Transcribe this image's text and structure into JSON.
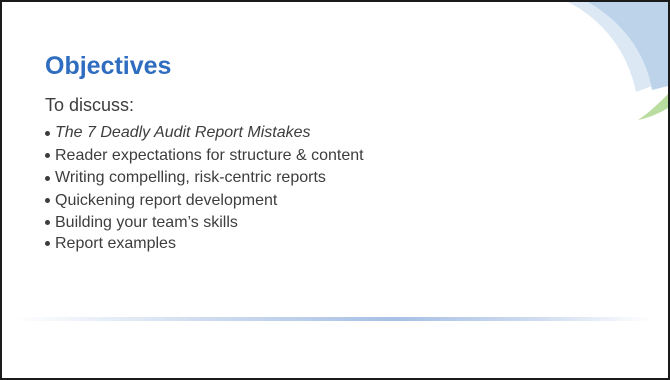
{
  "slide": {
    "title": "Objectives",
    "intro": "To discuss:",
    "bullets": [
      "The 7 Deadly Audit Report Mistakes",
      "Reader expectations for structure & content",
      "Writing compelling, risk-centric reports",
      "Quickening report development",
      "Building your team’s skills",
      "Report examples"
    ],
    "colors": {
      "title": "#2e6dbf",
      "text": "#3d3d3d",
      "deco_blue": "#bcd3ea",
      "deco_green": "#b9dca0"
    }
  }
}
